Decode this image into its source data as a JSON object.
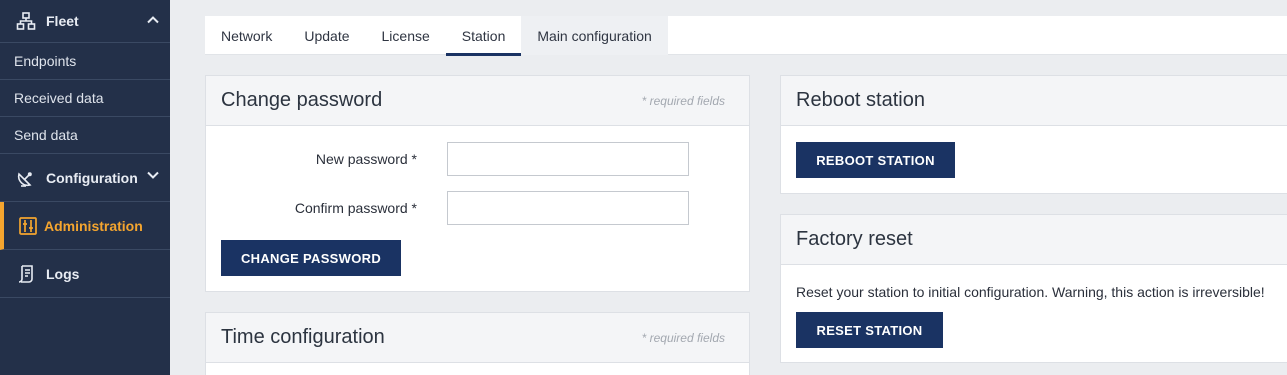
{
  "sidebar": {
    "header": {
      "label": "Fleet",
      "icon": "network-icon"
    },
    "sub_items": [
      {
        "label": "Endpoints"
      },
      {
        "label": "Received data"
      },
      {
        "label": "Send data"
      }
    ],
    "items": [
      {
        "label": "Configuration",
        "icon": "satellite-dish-icon"
      },
      {
        "label": "Administration",
        "icon": "admin-panel-icon"
      },
      {
        "label": "Logs",
        "icon": "scroll-icon"
      }
    ]
  },
  "tabs": [
    {
      "label": "Network"
    },
    {
      "label": "Update"
    },
    {
      "label": "License"
    },
    {
      "label": "Station"
    },
    {
      "label": "Main configuration"
    }
  ],
  "change_password": {
    "title": "Change password",
    "required_note": "* required fields",
    "new_password_label": "New password *",
    "new_password_value": "",
    "confirm_password_label": "Confirm password *",
    "confirm_password_value": "",
    "button": "CHANGE PASSWORD"
  },
  "time_configuration": {
    "title": "Time configuration",
    "required_note": "* required fields"
  },
  "reboot": {
    "title": "Reboot station",
    "button": "REBOOT STATION"
  },
  "factory_reset": {
    "title": "Factory reset",
    "message": "Reset your station to initial configuration. Warning, this action is irreversible!",
    "button": "RESET STATION"
  },
  "colors": {
    "sidebar_bg": "#233049",
    "accent": "#f4a52f",
    "primary_button": "#1a3363"
  }
}
